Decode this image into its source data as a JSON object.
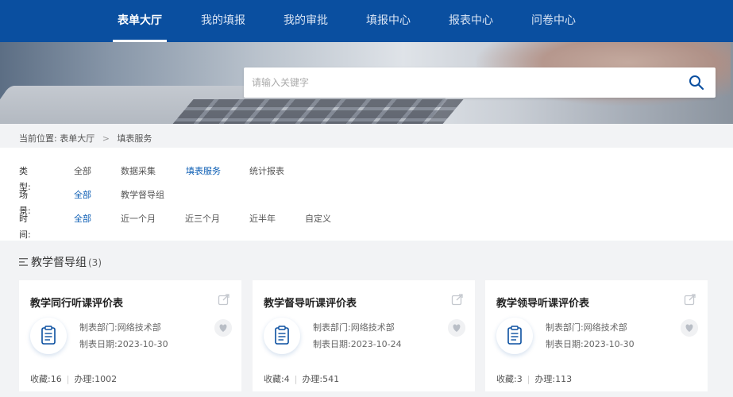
{
  "nav": {
    "items": [
      {
        "label": "表单大厅",
        "active": true
      },
      {
        "label": "我的填报",
        "active": false
      },
      {
        "label": "我的审批",
        "active": false
      },
      {
        "label": "填报中心",
        "active": false
      },
      {
        "label": "报表中心",
        "active": false
      },
      {
        "label": "问卷中心",
        "active": false
      }
    ]
  },
  "search": {
    "placeholder": "请输入关键字",
    "value": ""
  },
  "breadcrumb": {
    "prefix": "当前位置:",
    "items": [
      "表单大厅",
      "填表服务"
    ],
    "separator": ">"
  },
  "filters": {
    "type": {
      "label": "类型:",
      "options": [
        "全部",
        "数据采集",
        "填表服务",
        "统计报表"
      ],
      "selected": "填表服务"
    },
    "scene": {
      "label": "场景:",
      "options": [
        "全部",
        "教学督导组"
      ],
      "selected": "全部"
    },
    "time": {
      "label": "时间:",
      "options": [
        "全部",
        "近一个月",
        "近三个月",
        "近半年",
        "自定义"
      ],
      "selected": "全部"
    }
  },
  "section": {
    "title": "教学督导组",
    "count": "(3)"
  },
  "cards": [
    {
      "title": "教学同行听课评价表",
      "dept_label": "制表部门:",
      "dept": "网络技术部",
      "date_label": "制表日期:",
      "date": "2023-10-30",
      "fav_label": "收藏:",
      "fav": "16",
      "handle_label": "办理:",
      "handle": "1002"
    },
    {
      "title": "教学督导听课评价表",
      "dept_label": "制表部门:",
      "dept": "网络技术部",
      "date_label": "制表日期:",
      "date": "2023-10-24",
      "fav_label": "收藏:",
      "fav": "4",
      "handle_label": "办理:",
      "handle": "541"
    },
    {
      "title": "教学领导听课评价表",
      "dept_label": "制表部门:",
      "dept": "网络技术部",
      "date_label": "制表日期:",
      "date": "2023-10-30",
      "fav_label": "收藏:",
      "fav": "3",
      "handle_label": "办理:",
      "handle": "113"
    }
  ],
  "colors": {
    "primary": "#0a4fa0",
    "accent": "#0a5cb3"
  }
}
